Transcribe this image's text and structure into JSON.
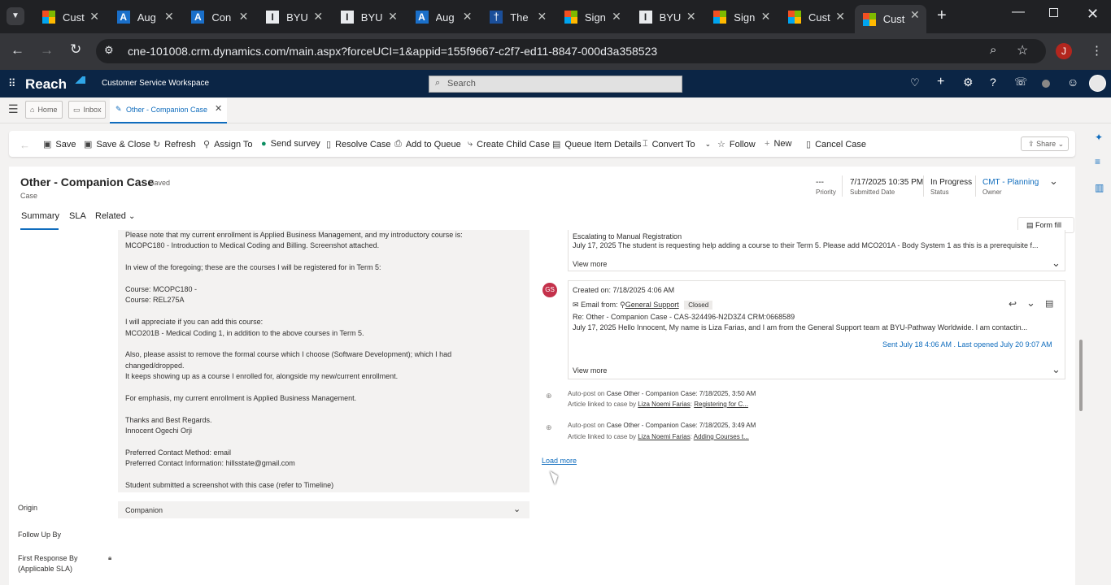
{
  "browser": {
    "tabs": [
      {
        "title": "Cust",
        "icon": "ms"
      },
      {
        "title": "Aug",
        "icon": "az"
      },
      {
        "title": "Con",
        "icon": "az"
      },
      {
        "title": "BYU",
        "icon": "byu"
      },
      {
        "title": "BYU",
        "icon": "byu"
      },
      {
        "title": "Aug",
        "icon": "az"
      },
      {
        "title": "The",
        "icon": "ppl"
      },
      {
        "title": "Sign",
        "icon": "ms"
      },
      {
        "title": "BYU",
        "icon": "byu"
      },
      {
        "title": "Sign",
        "icon": "ms"
      },
      {
        "title": "Cust",
        "icon": "ms"
      },
      {
        "title": "Cust",
        "icon": "ms",
        "active": true
      }
    ],
    "url": "cne-101008.crm.dynamics.com/main.aspx?forceUCI=1&appid=155f9667-c2f7-ed11-8847-000d3a358523",
    "profile_initial": "J"
  },
  "app": {
    "brand": "Reach",
    "name": "Customer Service Workspace",
    "search_placeholder": "Search"
  },
  "session_tabs": [
    {
      "label": "Home"
    },
    {
      "label": "Inbox"
    },
    {
      "label": "Other - Companion Case"
    }
  ],
  "commands": {
    "save": "Save",
    "save_close": "Save & Close",
    "refresh": "Refresh",
    "assign_to": "Assign To",
    "send_survey": "Send survey",
    "resolve_case": "Resolve Case",
    "add_to_queue": "Add to Queue",
    "create_child_case": "Create Child Case",
    "queue_item_details": "Queue Item Details",
    "convert_to": "Convert To",
    "follow": "Follow",
    "new": "New",
    "cancel_case": "Cancel Case",
    "share": "Share"
  },
  "record": {
    "title": "Other - Companion Case",
    "saved": "- Saved",
    "entity": "Case",
    "priority_value": "---",
    "priority_label": "Priority",
    "submitted_value": "7/17/2025 10:35 PM",
    "submitted_label": "Submitted Date",
    "status_value": "In Progress",
    "status_label": "Status",
    "owner_value": "CMT - Planning",
    "owner_label": "Owner",
    "form_fill": "Form fill"
  },
  "form_tabs": {
    "summary": "Summary",
    "sla": "SLA",
    "related": "Related"
  },
  "description_lines": [
    "Please note that my current enrollment is Applied Business Management, and my introductory course is:",
    "MCOPC180 - Introduction to Medical Coding and Billing. Screenshot attached.",
    "",
    "In view of the foregoing; these are the courses I will be registered for in Term 5:",
    "",
    "Course: MCOPC180 -",
    "Course: REL275A",
    "",
    "I will appreciate if you can add this course:",
    "MCO201B - Medical Coding 1, in addition to the above courses in Term 5.",
    "",
    "Also, please assist to remove the formal course which I choose (Software Development); which I had",
    "changed/dropped.",
    "It keeps showing up as a course I enrolled for, alongside my new/current enrollment.",
    "",
    "For emphasis, my current enrollment is Applied Business Management.",
    "",
    "Thanks and Best Regards.",
    "Innocent Ogechi Orji",
    "",
    "Preferred Contact Method: email",
    "Preferred Contact Information: hillsstate@gmail.com",
    "",
    "Student submitted a screenshot with this case (refer to Timeline)"
  ],
  "fields": {
    "origin_label": "Origin",
    "origin_value": "Companion",
    "followup_label": "Follow Up By",
    "first_response_label_1": "First Response By",
    "first_response_label_2": "(Applicable SLA)"
  },
  "timeline": {
    "card1": {
      "subject": "Escalating to Manual Registration",
      "body": "July 17, 2025 The student is requesting help adding a course to their Term 5. Please add MCO201A - Body System 1 as this is a prerequisite f...",
      "view_more": "View more"
    },
    "card2": {
      "avatar": "GS",
      "created": "Created on: 7/18/2025 4:06 AM",
      "from_label": "Email from:",
      "from_name": "General Support",
      "status": "Closed",
      "subject": "Re: Other - Companion Case - CAS-324496-N2D3Z4 CRM:0668589",
      "body": "July 17, 2025     Hello Innocent,    My name is Liza Farias, and I am from the General Support team at BYU-Pathway Worldwide. I am contactin...",
      "sent": "Sent July 18 4:06 AM . Last opened July 20 9:07 AM",
      "view_more": "View more"
    },
    "posts": [
      {
        "prefix": "Auto-post on",
        "case": "Case Other - Companion Case:",
        "time": "7/18/2025, 3:50 AM",
        "text": "Article linked to case by",
        "user": "Liza Noemi Farias",
        "sep": ":",
        "article": "Registering for C..."
      },
      {
        "prefix": "Auto-post on",
        "case": "Case Other - Companion Case:",
        "time": "7/18/2025, 3:49 AM",
        "text": "Article linked to case by",
        "user": "Liza Noemi Farias",
        "sep": ":",
        "article": "Adding Courses t..."
      }
    ],
    "load_more": "Load more"
  }
}
